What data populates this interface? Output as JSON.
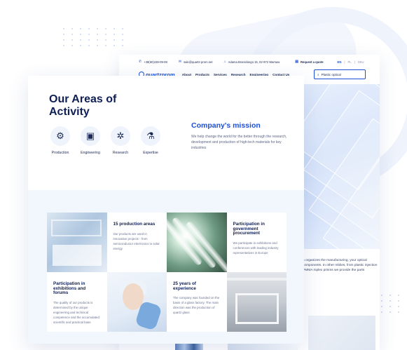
{
  "back_window": {
    "topbar": {
      "phone": "+48(60)159-09-08",
      "email": "sale@quartz-prom.net",
      "address": "Adama Branickiego 15, 02-972 Warsaw",
      "request_quote": "Request a quote",
      "languages": [
        "EN",
        "PL",
        "DEU"
      ],
      "active_language": "EN"
    },
    "nav": {
      "logo": "quartzprom",
      "items": [
        "About",
        "Products",
        "Services",
        "Research",
        "Engineering",
        "Contact Us"
      ]
    },
    "search": {
      "value": "Plastic optical"
    },
    "body_text": "n organizes the manufacturing, your optical components. In other mblies, from plastic injection PMMA mplex prisms we provide the parts"
  },
  "front_card": {
    "title": "Our Areas of Activity",
    "activities": [
      {
        "label": "Production",
        "icon": "robot-arm-icon"
      },
      {
        "label": "Engineering",
        "icon": "monitor-icon"
      },
      {
        "label": "Research",
        "icon": "gears-icon"
      },
      {
        "label": "Expertise",
        "icon": "microscope-icon"
      }
    ],
    "mission": {
      "title": "Company's mission",
      "text": "We help change the world for the better through the research, development and production of high-tech materials for key industries"
    },
    "tiles": [
      {
        "title": "15 production areas",
        "text": "Our products are used in innovative projects - from semiconductor electronics to solar energy"
      },
      {
        "title": "Participation in government procurement",
        "text": "We participate in exhibitions and conferences with leading industry representatives in Europe"
      },
      {
        "title": "Participation in exhibitions and forums",
        "text": "The quality of our products is determined by the unique engineering and technical competence and the accumulated scientific and practical base"
      },
      {
        "title": "25 years of experience",
        "text": "The company was founded on the basis of a glass factory. The main direction was the production of quartz glass"
      }
    ]
  },
  "colors": {
    "accent": "#1d4fd8",
    "heading": "#0f1f55",
    "band": "#f2f6fd"
  }
}
